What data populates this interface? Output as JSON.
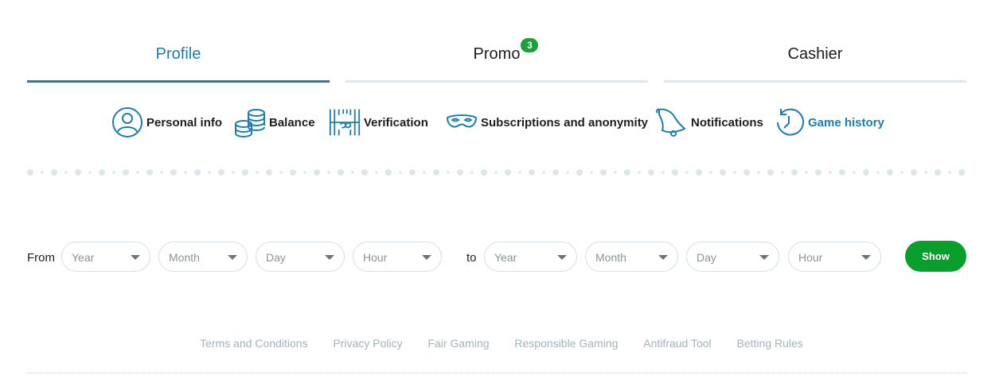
{
  "tabs": [
    {
      "label": "Profile",
      "active": true
    },
    {
      "label": "Promo",
      "badge": "3"
    },
    {
      "label": "Cashier"
    }
  ],
  "subnav": [
    {
      "label": "Personal info",
      "icon": "user-circle-icon"
    },
    {
      "label": "Balance",
      "icon": "coins-stack-icon"
    },
    {
      "label": "Verification",
      "icon": "passport-barcode-icon"
    },
    {
      "label": "Subscriptions and anonymity",
      "icon": "mask-icon"
    },
    {
      "label": "Notifications",
      "icon": "bell-icon"
    },
    {
      "label": "Game history",
      "icon": "history-clock-icon",
      "active": true
    }
  ],
  "filter": {
    "from_label": "From",
    "to_label": "to",
    "from": {
      "year": "Year",
      "month": "Month",
      "day": "Day",
      "hour": "Hour"
    },
    "to": {
      "year": "Year",
      "month": "Month",
      "day": "Day",
      "hour": "Hour"
    },
    "show_label": "Show"
  },
  "footer": {
    "links": [
      "Terms and Conditions",
      "Privacy Policy",
      "Fair Gaming",
      "Responsible Gaming",
      "Antifraud Tool",
      "Betting Rules"
    ]
  },
  "colors": {
    "accent": "#1b7fae",
    "button": "#0a9f2c",
    "badge": "#1aa138",
    "muted": "#a3b3ba"
  }
}
